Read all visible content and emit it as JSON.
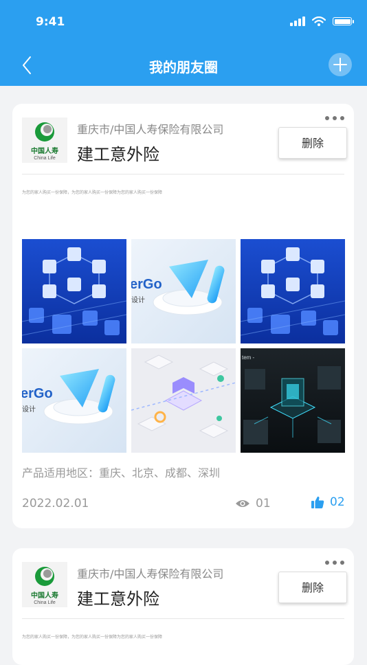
{
  "status_bar": {
    "time": "9:41"
  },
  "nav": {
    "title": "我的朋友圈"
  },
  "brand": {
    "logo_cn": "中国人寿",
    "logo_en": "China Life"
  },
  "posts": [
    {
      "company": "重庆市/中国人寿保险有限公司",
      "product": "建工意外险",
      "delete_label": "删除",
      "description": "为您的家人购买一份保障，为您的家人购买一份保障为您的家人购买一份保障",
      "images": [
        "blue-cubes",
        "logo-3d",
        "blue-cubes",
        "logo-3d",
        "isometric-city",
        "chip-circuit"
      ],
      "region": "产品适用地区：重庆、北京、成都、深圳",
      "date": "2022.02.01",
      "views": "01",
      "likes": "02"
    },
    {
      "company": "重庆市/中国人寿保险有限公司",
      "product": "建工意外险",
      "delete_label": "删除",
      "description": "为您的家人购买一份保障，为您的家人购买一份保障为您的家人购买一份保障"
    }
  ],
  "image_text": {
    "brand_fragment": "erGo",
    "design_fragment": "设计",
    "tech_fragment": "tem -"
  },
  "colors": {
    "header": "#2b9ff0",
    "accent": "#2b9ff0",
    "background": "#f2f3f5"
  }
}
